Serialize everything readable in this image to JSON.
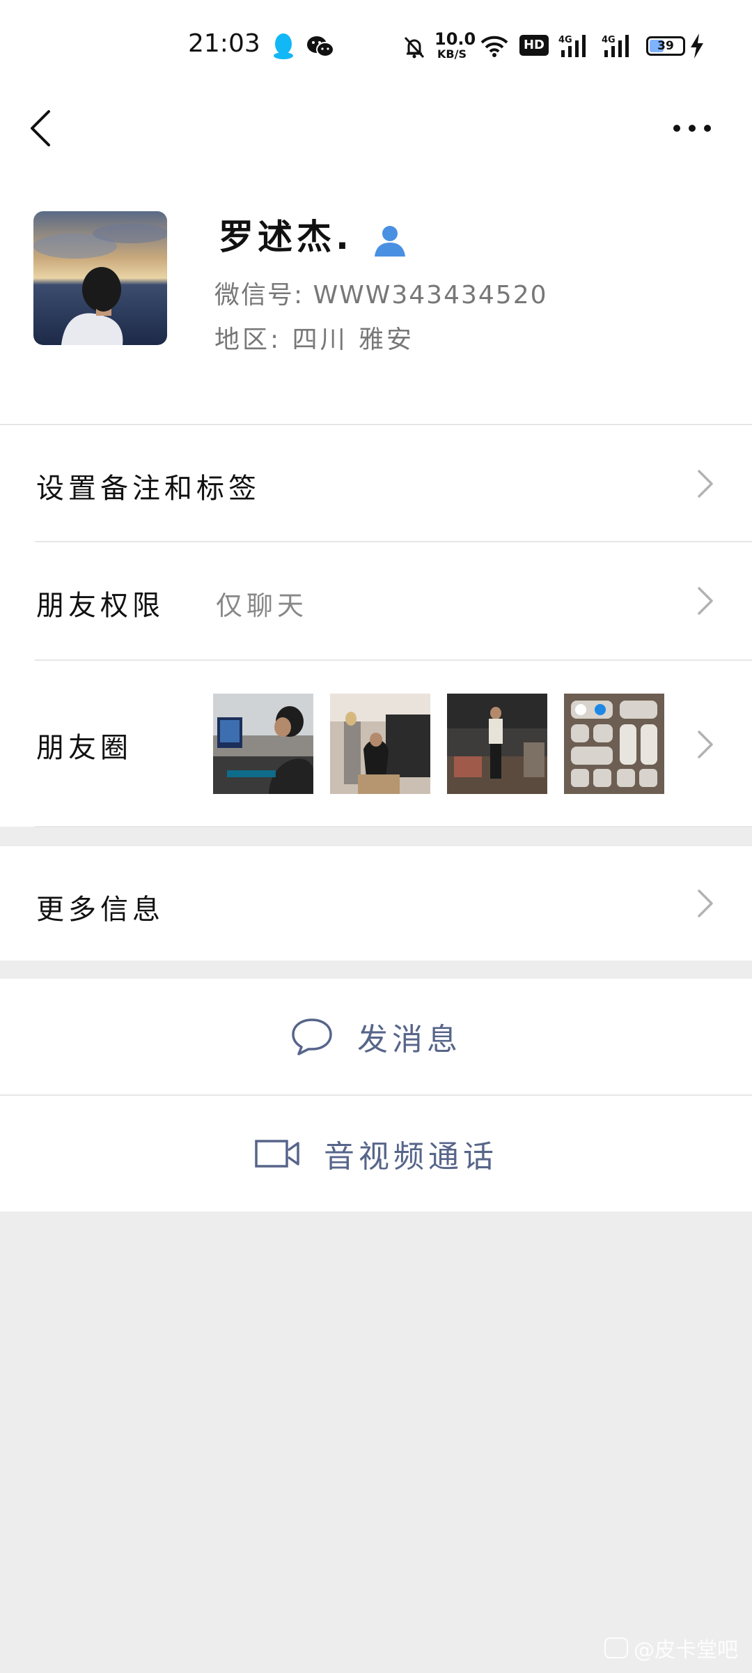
{
  "status_bar": {
    "time": "21:03",
    "net_speed_value": "10.0",
    "net_speed_unit": "KB/S",
    "hd_badge": "HD",
    "signal1_label": "4G",
    "signal2_label": "4G",
    "battery_level": "39",
    "icons": [
      "qq-icon",
      "wechat-icon",
      "bell-muted-icon",
      "wifi-icon",
      "signal-icon",
      "battery-icon",
      "charging-icon"
    ]
  },
  "header": {
    "icons": [
      "back-chevron-icon",
      "more-dots-icon"
    ]
  },
  "profile": {
    "name": "罗述杰.",
    "wechat_id": "微信号: WWW343434520",
    "region": "地区: 四川 雅安"
  },
  "rows": {
    "remark_label": "设置备注和标签",
    "permissions_label": "朋友权限",
    "permissions_value": "仅聊天",
    "moments_label": "朋友圈",
    "more_info_label": "更多信息"
  },
  "actions": {
    "message_label": "发消息",
    "call_label": "音视频通话"
  },
  "watermark": {
    "text": "@皮卡堂吧"
  },
  "colors": {
    "background": "#ededed",
    "action_text": "#57658a",
    "accent_blue": "#4a90e2"
  }
}
